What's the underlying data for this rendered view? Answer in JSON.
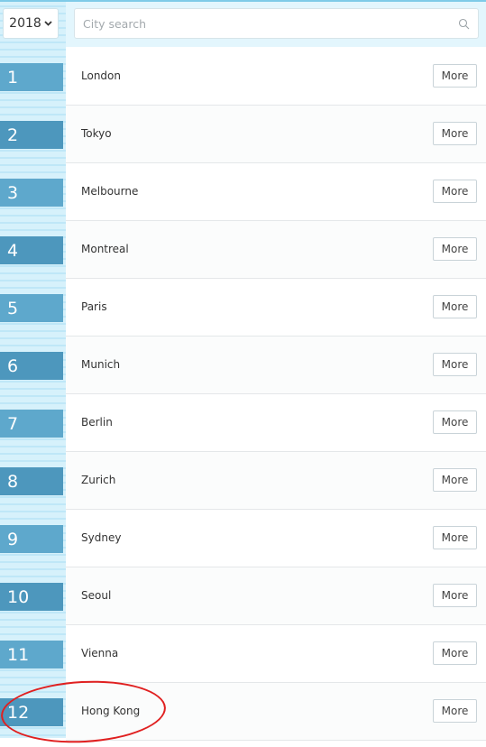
{
  "filters": {
    "year": "2018",
    "search_placeholder": "City search"
  },
  "rankings": [
    {
      "rank": "1",
      "city": "London",
      "more": "More"
    },
    {
      "rank": "2",
      "city": "Tokyo",
      "more": "More"
    },
    {
      "rank": "3",
      "city": "Melbourne",
      "more": "More"
    },
    {
      "rank": "4",
      "city": "Montreal",
      "more": "More"
    },
    {
      "rank": "5",
      "city": "Paris",
      "more": "More"
    },
    {
      "rank": "6",
      "city": "Munich",
      "more": "More"
    },
    {
      "rank": "7",
      "city": "Berlin",
      "more": "More"
    },
    {
      "rank": "8",
      "city": "Zurich",
      "more": "More"
    },
    {
      "rank": "9",
      "city": "Sydney",
      "more": "More"
    },
    {
      "rank": "10",
      "city": "Seoul",
      "more": "More"
    },
    {
      "rank": "11",
      "city": "Vienna",
      "more": "More"
    },
    {
      "rank": "12",
      "city": "Hong Kong",
      "more": "More"
    }
  ],
  "colors": {
    "accent": "#5ea8cc",
    "column_background": "#bfe7f7",
    "highlight_circle": "#e02020"
  },
  "icons": {
    "year_dropdown": "chevron-down-icon",
    "search": "search-icon"
  }
}
